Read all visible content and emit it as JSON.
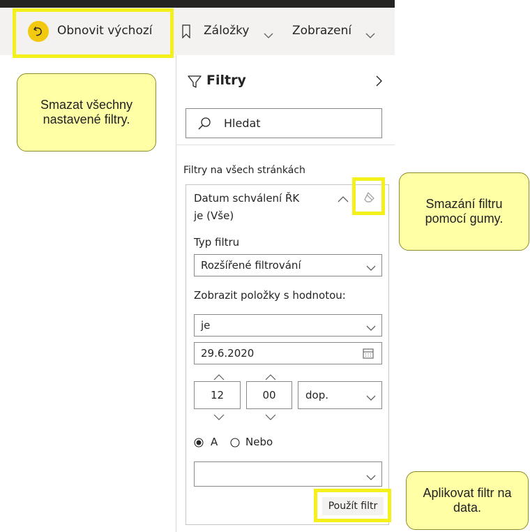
{
  "toolbar": {
    "reset_label": "Obnovit výchozí",
    "bookmarks_label": "Záložky",
    "view_label": "Zobrazení"
  },
  "callouts": {
    "clear_all": "Smazat všechny nastavené filtry.",
    "eraser": "Smazání filtru pomocí gumy.",
    "apply": "Aplikovat filtr na data."
  },
  "filters_pane": {
    "title": "Filtry",
    "search_placeholder": "Hledat",
    "section_label": "Filtry na všech stránkách",
    "filter_card": {
      "field_name": "Datum schválení ŘK",
      "summary": "je (Vše)",
      "filter_type_label": "Typ filtru",
      "filter_type_value": "Rozšířené filtrování",
      "show_items_label": "Zobrazit položky s hodnotou:",
      "operator_value": "je",
      "date_value": "29.6.2020",
      "hour_value": "12",
      "minute_value": "00",
      "ampm_value": "dop.",
      "and_label": "A",
      "or_label": "Nebo",
      "second_operator_value": "",
      "apply_button": "Použít filtr"
    }
  }
}
